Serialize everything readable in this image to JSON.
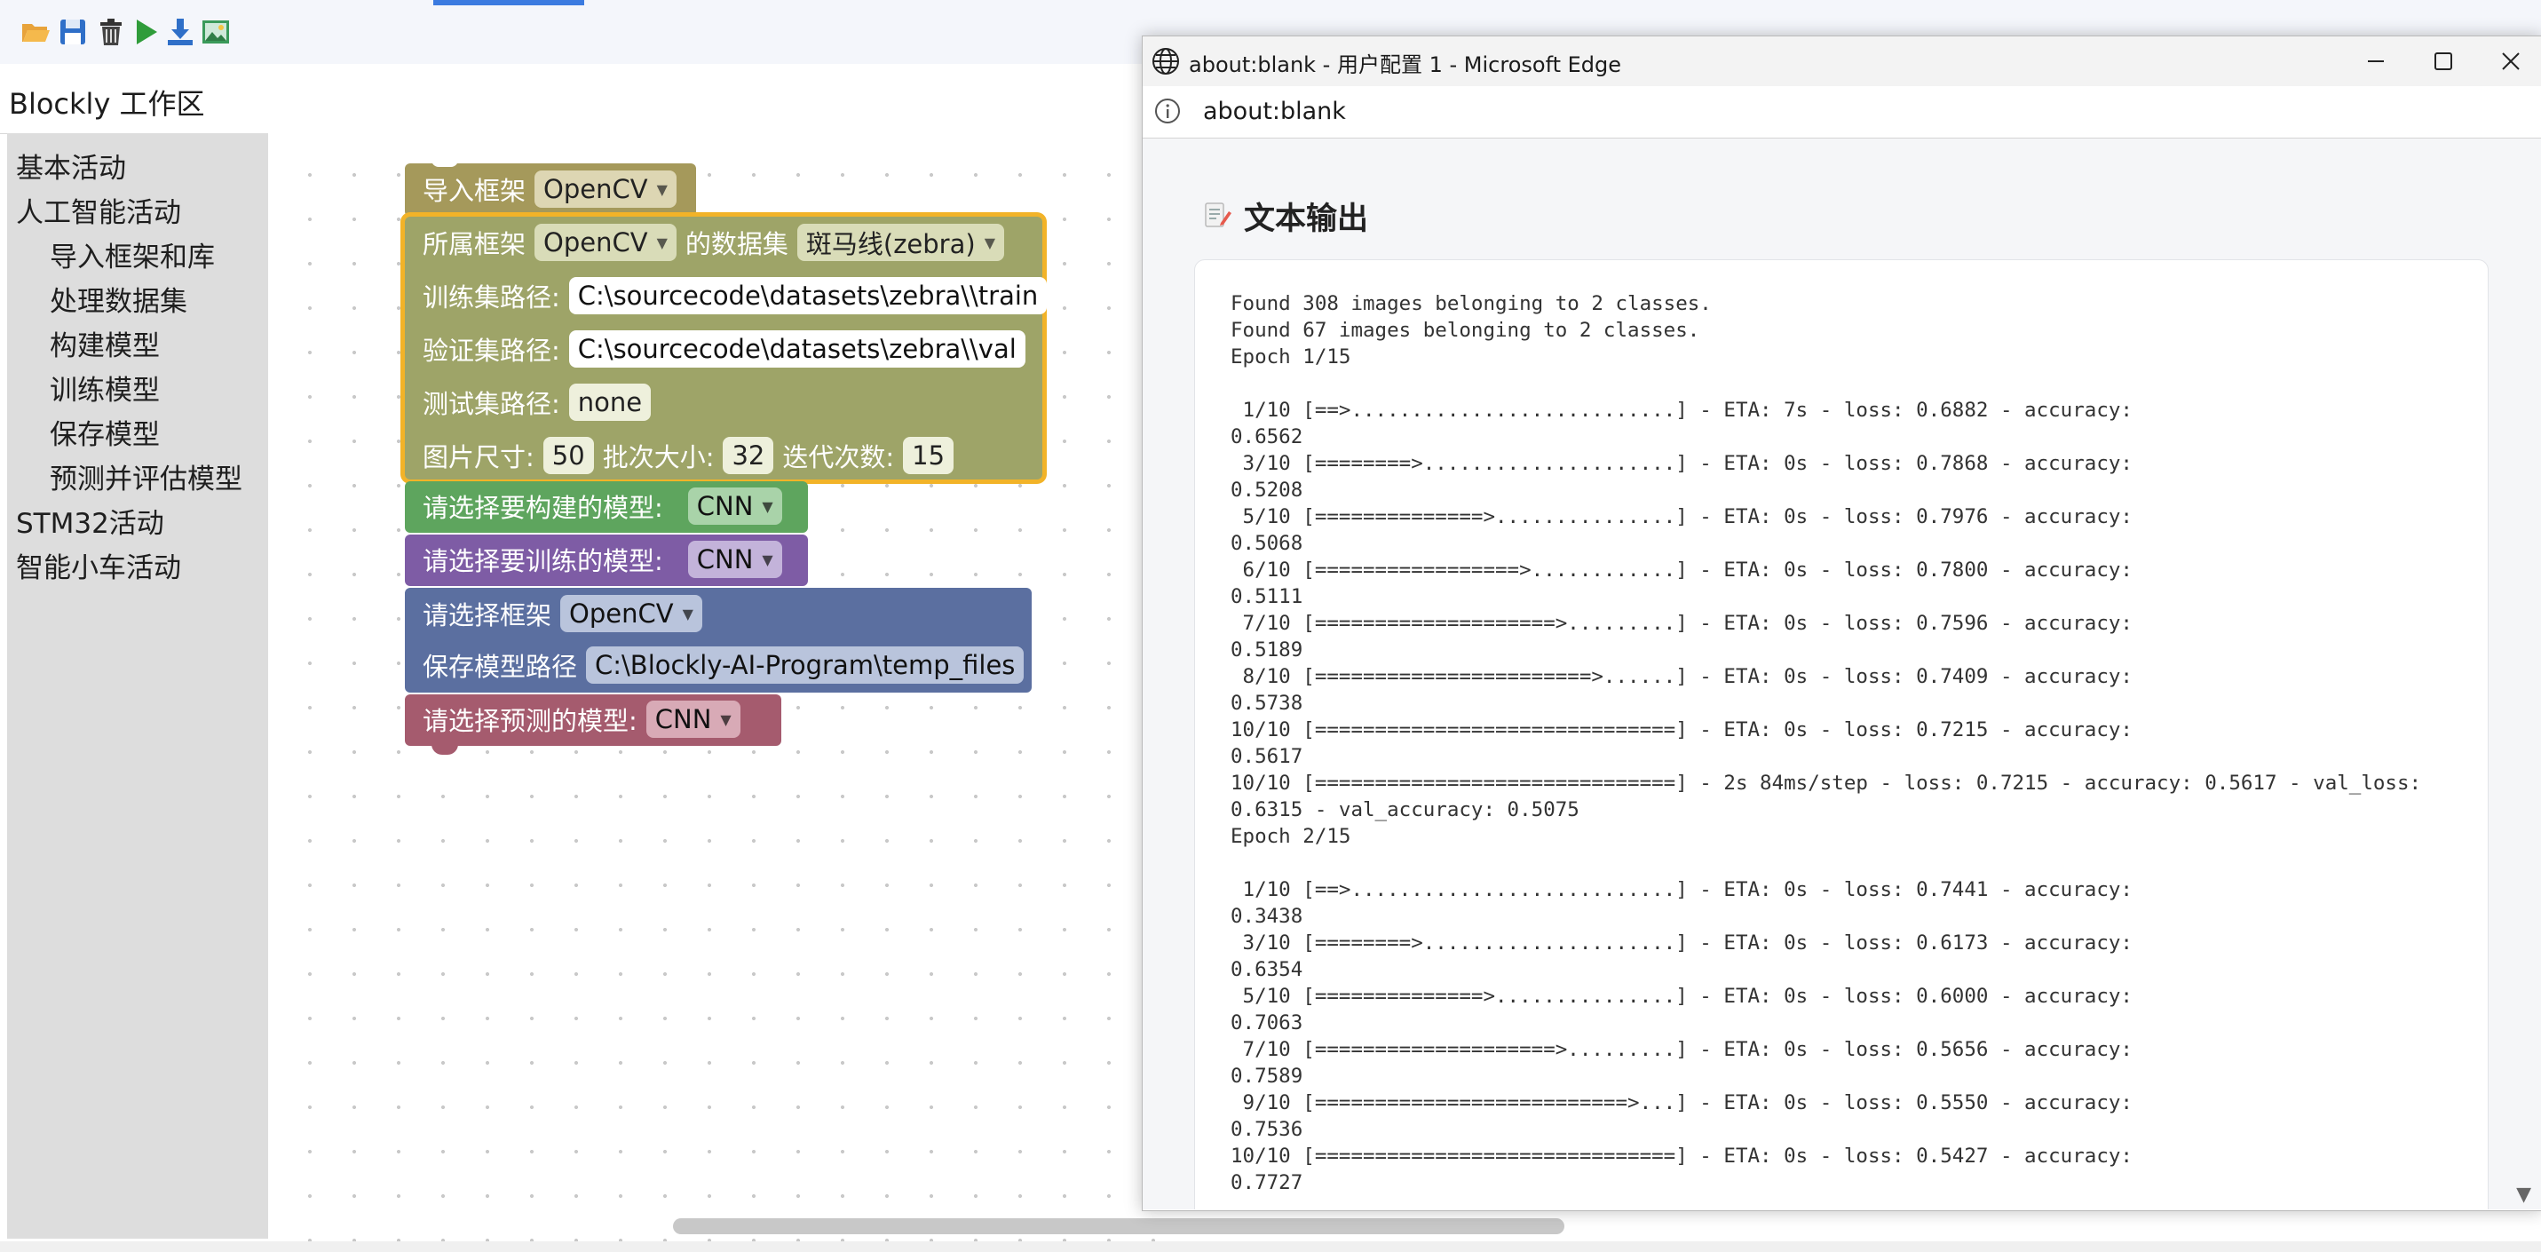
{
  "toolbar": {
    "icons": [
      "folder-open-icon",
      "save-icon",
      "trash-icon",
      "run-icon",
      "download-icon",
      "image-icon"
    ]
  },
  "workspace": {
    "title": "Blockly 工作区"
  },
  "toolbox": {
    "categories": [
      {
        "label": "基本活动",
        "level": 0
      },
      {
        "label": "人工智能活动",
        "level": 0
      },
      {
        "label": "导入框架和库",
        "level": 1
      },
      {
        "label": "处理数据集",
        "level": 1
      },
      {
        "label": "构建模型",
        "level": 1
      },
      {
        "label": "训练模型",
        "level": 1
      },
      {
        "label": "保存模型",
        "level": 1
      },
      {
        "label": "预测并评估模型",
        "level": 1
      },
      {
        "label": "STM32活动",
        "level": 0
      },
      {
        "label": "智能小车活动",
        "level": 0
      }
    ]
  },
  "blocks": {
    "import": {
      "label": "导入框架",
      "framework": "OpenCV"
    },
    "dataset": {
      "framework_label": "所属框架",
      "framework": "OpenCV",
      "dataset_label": "的数据集",
      "dataset": "斑马线(zebra)",
      "train_label": "训练集路径:",
      "train_path": "C:\\sourcecode\\datasets\\zebra\\\\train",
      "val_label": "验证集路径:",
      "val_path": "C:\\sourcecode\\datasets\\zebra\\\\val",
      "test_label": "测试集路径:",
      "test_path": "none",
      "size_label": "图片尺寸:",
      "size": "50",
      "batch_label": "批次大小:",
      "batch": "32",
      "epochs_label": "迭代次数:",
      "epochs": "15"
    },
    "build": {
      "label": "请选择要构建的模型:",
      "model": "CNN"
    },
    "train": {
      "label": "请选择要训练的模型:",
      "model": "CNN"
    },
    "save": {
      "framework_label": "请选择框架",
      "framework": "OpenCV",
      "path_label": "保存模型路径",
      "path": "C:\\Blockly-AI-Program\\temp_files"
    },
    "predict": {
      "label": "请选择预测的模型:",
      "model": "CNN"
    }
  },
  "colors": {
    "import": "#a5995b",
    "dataset": "#9ea468",
    "dataset_border": "#f2b328",
    "build": "#5ea55e",
    "train": "#7e5ca5",
    "save": "#5b6fa0",
    "predict": "#a55b6e"
  },
  "browser": {
    "title": "about:blank - 用户配置 1 - Microsoft Edge",
    "address": "about:blank",
    "heading": "文本输出",
    "log_lines": [
      "Found 308 images belonging to 2 classes.",
      "Found 67 images belonging to 2 classes.",
      "Epoch 1/15",
      "",
      " 1/10 [==>...........................] - ETA: 7s - loss: 0.6882 - accuracy:",
      "0.6562",
      " 3/10 [========>.....................] - ETA: 0s - loss: 0.7868 - accuracy:",
      "0.5208",
      " 5/10 [==============>...............] - ETA: 0s - loss: 0.7976 - accuracy:",
      "0.5068",
      " 6/10 [=================>............] - ETA: 0s - loss: 0.7800 - accuracy:",
      "0.5111",
      " 7/10 [====================>.........] - ETA: 0s - loss: 0.7596 - accuracy:",
      "0.5189",
      " 8/10 [=======================>......] - ETA: 0s - loss: 0.7409 - accuracy:",
      "0.5738",
      "10/10 [==============================] - ETA: 0s - loss: 0.7215 - accuracy:",
      "0.5617",
      "10/10 [==============================] - 2s 84ms/step - loss: 0.7215 - accuracy: 0.5617 - val_loss:",
      "0.6315 - val_accuracy: 0.5075",
      "Epoch 2/15",
      "",
      " 1/10 [==>...........................] - ETA: 0s - loss: 0.7441 - accuracy:",
      "0.3438",
      " 3/10 [========>.....................] - ETA: 0s - loss: 0.6173 - accuracy:",
      "0.6354",
      " 5/10 [==============>...............] - ETA: 0s - loss: 0.6000 - accuracy:",
      "0.7063",
      " 7/10 [====================>.........] - ETA: 0s - loss: 0.5656 - accuracy:",
      "0.7589",
      " 9/10 [==========================>...] - ETA: 0s - loss: 0.5550 - accuracy:",
      "0.7536",
      "10/10 [==============================] - ETA: 0s - loss: 0.5427 - accuracy:",
      "0.7727"
    ]
  }
}
